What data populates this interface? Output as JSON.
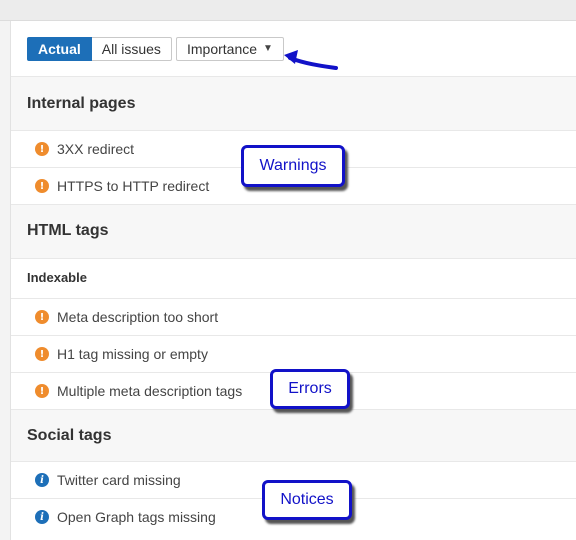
{
  "toolbar": {
    "tabs": [
      {
        "label": "Actual",
        "active": true
      },
      {
        "label": "All issues",
        "active": false
      }
    ],
    "sort_label": "Importance"
  },
  "sections": [
    {
      "title": "Internal pages",
      "items": [
        {
          "label": "3XX redirect",
          "icon": "warning-icon"
        },
        {
          "label": "HTTPS to HTTP redirect",
          "icon": "warning-icon"
        }
      ]
    },
    {
      "title": "HTML tags",
      "subsection": "Indexable",
      "items": [
        {
          "label": "Meta description too short",
          "icon": "warning-icon"
        },
        {
          "label": "H1 tag missing or empty",
          "icon": "warning-icon"
        },
        {
          "label": "Multiple meta description tags",
          "icon": "warning-icon"
        }
      ]
    },
    {
      "title": "Social tags",
      "items": [
        {
          "label": "Twitter card missing",
          "icon": "info-icon"
        },
        {
          "label": "Open Graph tags missing",
          "icon": "info-icon"
        }
      ]
    }
  ],
  "callouts": {
    "warnings": "Warnings",
    "errors": "Errors",
    "notices": "Notices"
  },
  "colors": {
    "accent": "#1d6fb8",
    "warning": "#ef8c2d",
    "callout": "#1212c8"
  }
}
